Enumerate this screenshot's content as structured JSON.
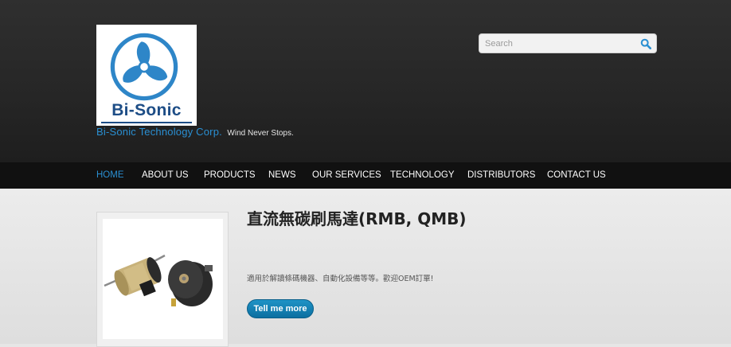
{
  "branding": {
    "logo_text": "Bi-Sonic",
    "company_name": "Bi-Sonic Technology Corp.",
    "motto": "Wind Never Stops."
  },
  "search": {
    "placeholder": "Search",
    "value": ""
  },
  "nav": {
    "items": [
      {
        "label": "HOME",
        "active": true
      },
      {
        "label": "ABOUT US",
        "active": false
      },
      {
        "label": "PRODUCTS",
        "active": false
      },
      {
        "label": "NEWS",
        "active": false
      },
      {
        "label": "OUR SERVICES",
        "active": false
      },
      {
        "label": "TECHNOLOGY",
        "active": false
      },
      {
        "label": "DISTRIBUTORS",
        "active": false
      },
      {
        "label": "CONTACT US",
        "active": false
      }
    ]
  },
  "product": {
    "title": "直流無碳刷馬達(RMB, QMB)",
    "description": "適用於解讀條碼機器、自動化設備等等。歡迎OEM訂單!",
    "button_label": "Tell me more"
  },
  "colors": {
    "accent": "#2a8fd2",
    "header_bg": "#2a2a2a",
    "nav_bg": "#111111",
    "logo_blue": "#1d4d86",
    "button": "#1480b4"
  }
}
